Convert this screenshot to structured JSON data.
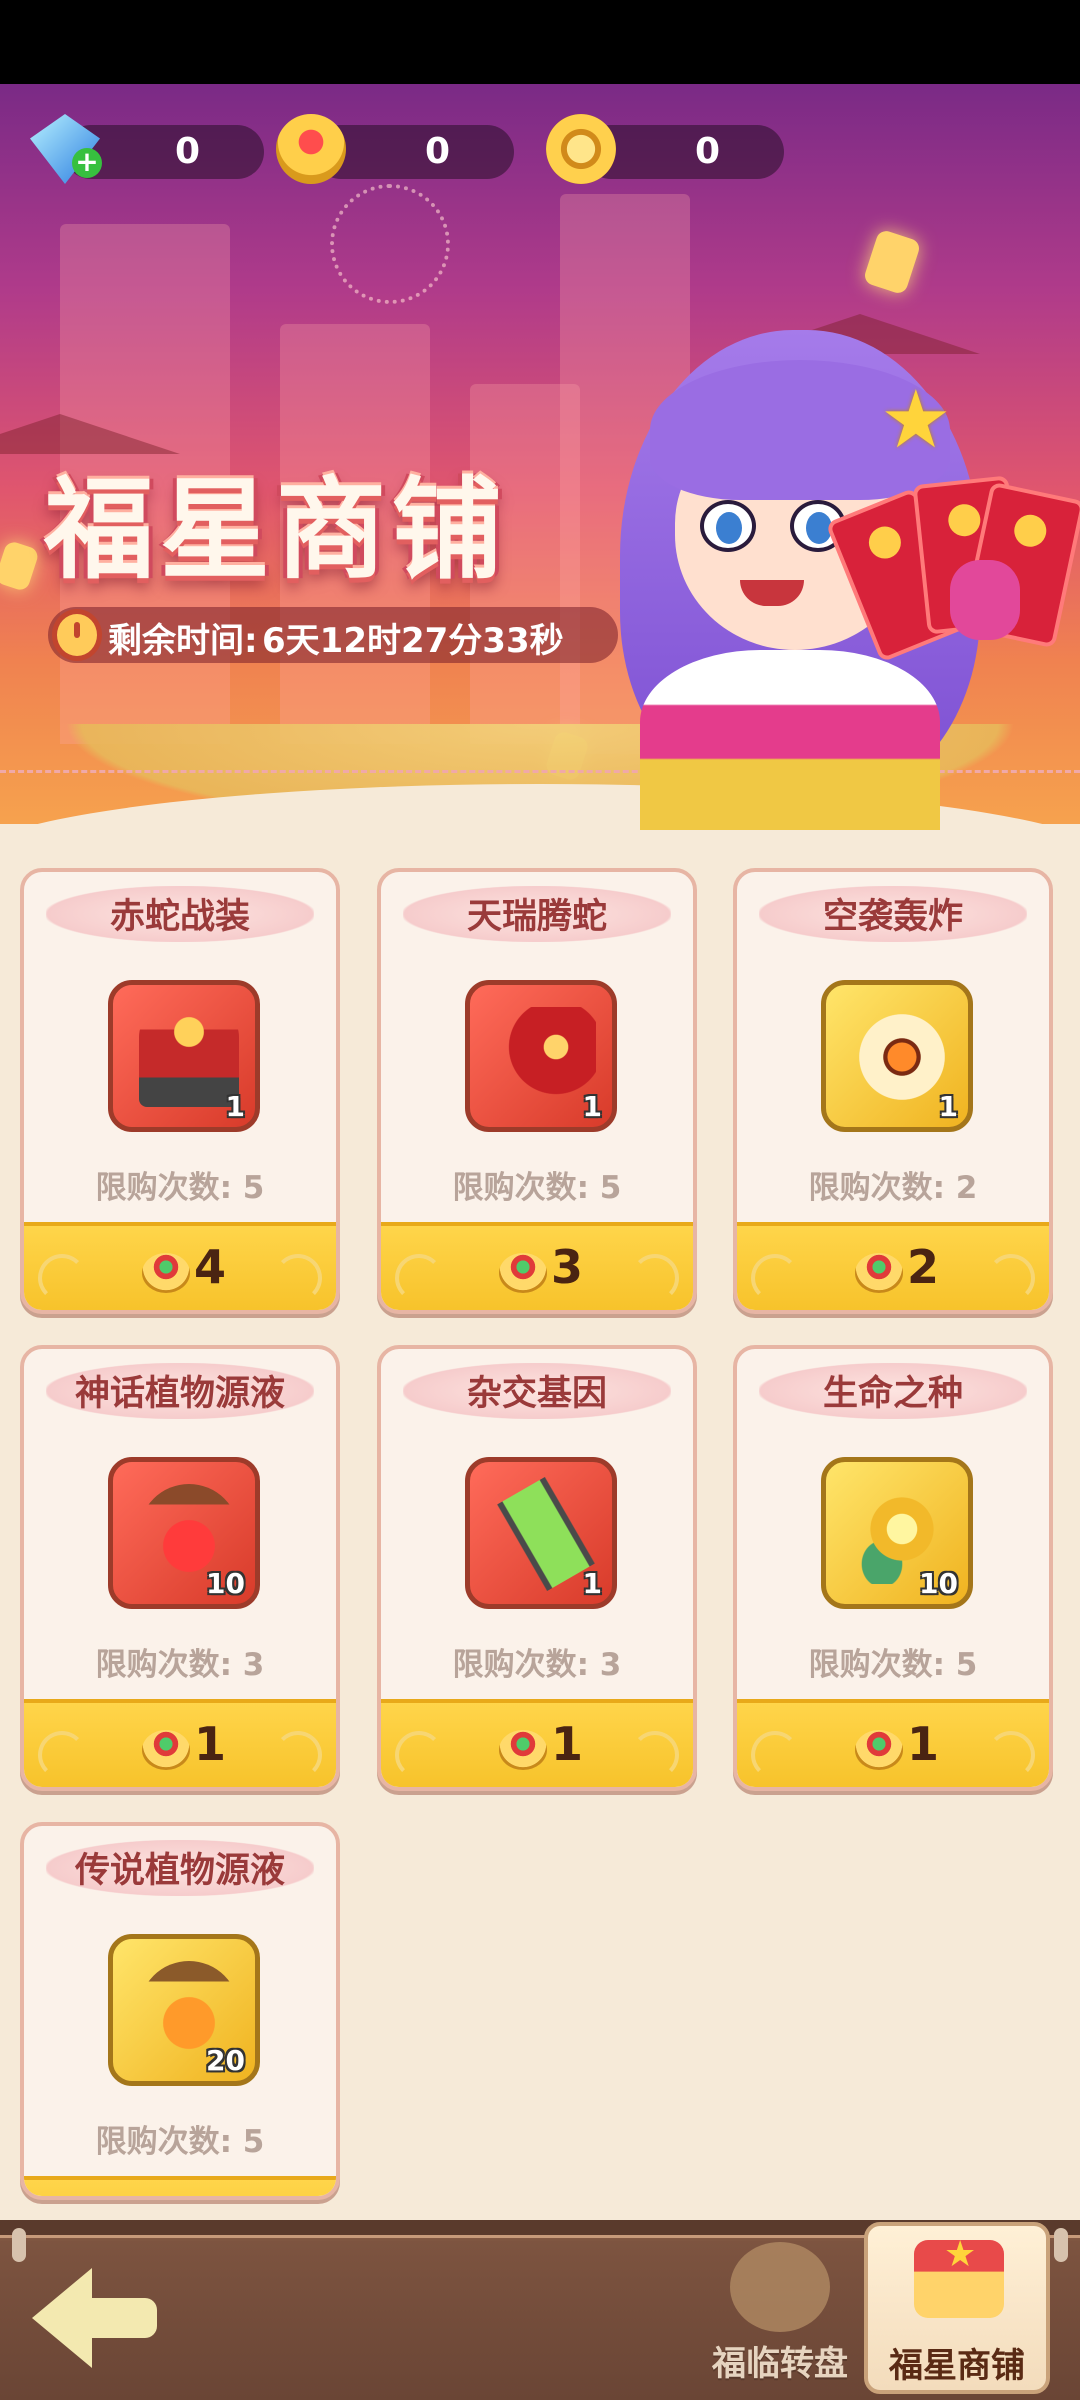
{
  "currencies": [
    {
      "icon": "diamond-icon",
      "value": "0"
    },
    {
      "icon": "ingot-icon",
      "value": "0"
    },
    {
      "icon": "coin-icon",
      "value": "0"
    }
  ],
  "banner": {
    "title": "福星商铺",
    "timer_label": "剩余时间:",
    "timer_value": "6天12时27分33秒"
  },
  "items": [
    {
      "name": "赤蛇战装",
      "icon": "red-armor-icon",
      "quantity": "1",
      "limit": "限购次数: 5",
      "price": "4",
      "frame": "red"
    },
    {
      "name": "天瑞腾蛇",
      "icon": "red-dragon-icon",
      "quantity": "1",
      "limit": "限购次数: 5",
      "price": "3",
      "frame": "red"
    },
    {
      "name": "空袭轰炸",
      "icon": "air-strike-card-icon",
      "quantity": "1",
      "limit": "限购次数: 2",
      "price": "2",
      "frame": "gold"
    },
    {
      "name": "神话植物源液",
      "icon": "red-potion-icon",
      "quantity": "10",
      "limit": "限购次数: 3",
      "price": "1",
      "frame": "red"
    },
    {
      "name": "杂交基因",
      "icon": "gene-tube-icon",
      "quantity": "1",
      "limit": "限购次数: 3",
      "price": "1",
      "frame": "red"
    },
    {
      "name": "生命之种",
      "icon": "life-seed-icon",
      "quantity": "10",
      "limit": "限购次数: 5",
      "price": "1",
      "frame": "gold"
    },
    {
      "name": "传说植物源液",
      "icon": "orange-potion-icon",
      "quantity": "20",
      "limit": "限购次数: 5",
      "price": "",
      "frame": "gold"
    }
  ],
  "bottom_nav": {
    "wheel_label": "福临转盘",
    "shop_label": "福星商铺"
  },
  "colors": {
    "accent_gold": "#f6c128",
    "title_red": "#9a3a3a",
    "bottom_bar_brown": "#6a4535"
  }
}
